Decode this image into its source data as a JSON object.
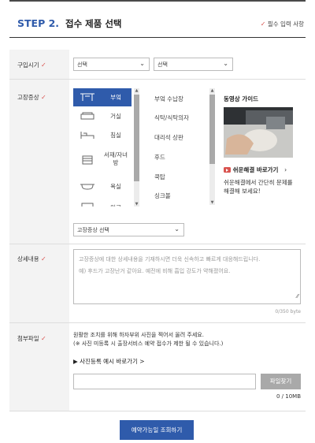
{
  "header": {
    "step": "STEP 2.",
    "title": "접수 제품 선택",
    "required_note": "필수 입력 사항",
    "check": "✓"
  },
  "purchase": {
    "label": "구입시기",
    "select1": "선택",
    "select2": "선택"
  },
  "symptom": {
    "label": "고장증상",
    "categories": [
      "부엌",
      "거실",
      "침실",
      "서재/자녀방",
      "욕실",
      "미로"
    ],
    "subitems": [
      "부엌 수납장",
      "식탁/식탁의자",
      "대리석 상판",
      "후드",
      "쿡탑",
      "싱크볼"
    ],
    "select_placeholder": "고장증상 선택"
  },
  "video": {
    "title": "동영상 가이드",
    "link": "쉬운해결 바로가기",
    "link_arrow": "›",
    "description": "쉬운해결에서 간단히 문제를 해결해 보세요!"
  },
  "detail": {
    "label": "상세내용",
    "placeholder_line1": "고장증상에 대한 상세내용을 기재하시면 더욱 신속하고 빠르게 대응해드립니다.",
    "placeholder_line2": "예) 후드가 고장난거 같아요. 예전에 비해 흡입 강도가 약해졌어요.",
    "counter": "0/350 byte"
  },
  "attach": {
    "label": "첨부파일",
    "note1": "원활한 조치를 위해 하자부위 사진을 찍어서 올려 주세요.",
    "note2": "(※ 사진 미등록 시 출장서비스 예약 접수가 제한 될 수 있습니다.)",
    "example_link": "▶ 사진등록 예시 바로가기 >",
    "button": "파일찾기",
    "size": "0 / 10MB"
  },
  "submit": {
    "label": "예약가능일 조회하기"
  },
  "colors": {
    "accent": "#2f5bab",
    "required": "#d9534f",
    "youtube": "#d9534f"
  }
}
